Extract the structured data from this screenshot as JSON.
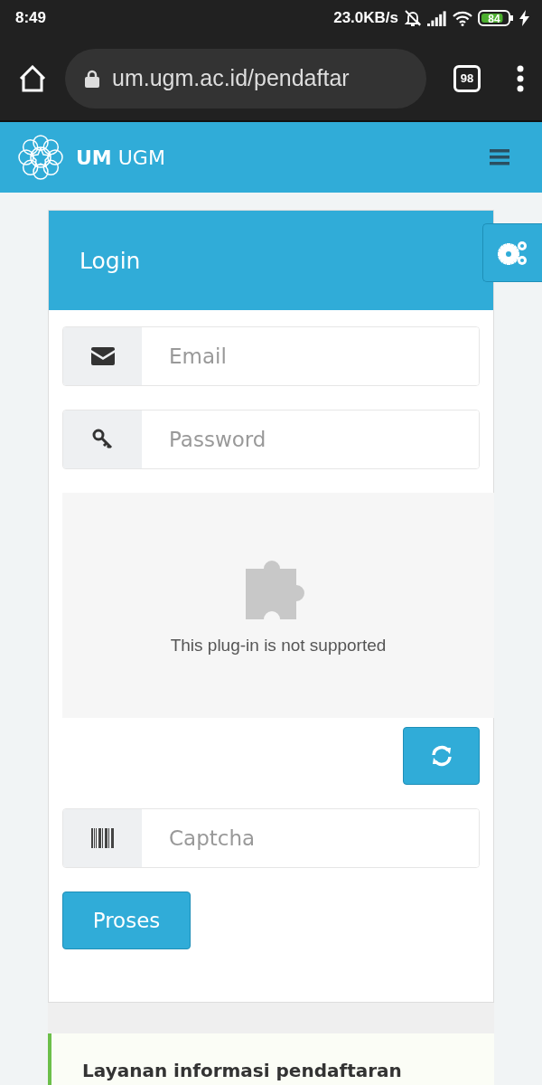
{
  "status_bar": {
    "time": "8:49",
    "speed": "23.0KB/s",
    "battery": "84",
    "charging": true
  },
  "browser": {
    "url": "um.ugm.ac.id/pendaftar",
    "tab_count": "98"
  },
  "navbar": {
    "brand": "**UM** UGM"
  },
  "login": {
    "title": "Login",
    "fields": [
      {
        "kind": "email",
        "placeholder": "Email"
      },
      {
        "kind": "password",
        "placeholder": "Password"
      }
    ],
    "plugin_message": "This plug-in is not supported",
    "captcha": {
      "kind": "captcha",
      "placeholder": "Captcha"
    },
    "submit": "Proses"
  },
  "info": {
    "title": "Layanan informasi pendaftaran"
  }
}
